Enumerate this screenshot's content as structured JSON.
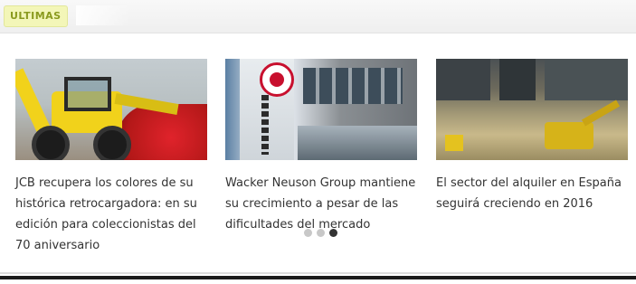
{
  "header": {
    "tab_label": "ULTIMAS"
  },
  "carousel": {
    "cards": [
      {
        "image": "backhoe-loader-photo",
        "headline": "JCB recupera los colores de su histórica retrocargadora: en su edición para coleccionistas del 70 aniversario"
      },
      {
        "image": "wacker-neuson-building-photo",
        "headline": "Wacker Neuson Group mantiene su crecimiento a pesar de las dificultades del mercado"
      },
      {
        "image": "construction-site-photo",
        "headline": "El sector del alquiler en España seguirá creciendo en 2016"
      }
    ],
    "pagination": {
      "count": 3,
      "active_index": 2
    }
  },
  "colors": {
    "tab_bg": "#f3f6b8",
    "tab_text": "#8a9a1e",
    "text": "#333333",
    "dot_active": "#333333",
    "dot_inactive": "#c8c8c8"
  }
}
